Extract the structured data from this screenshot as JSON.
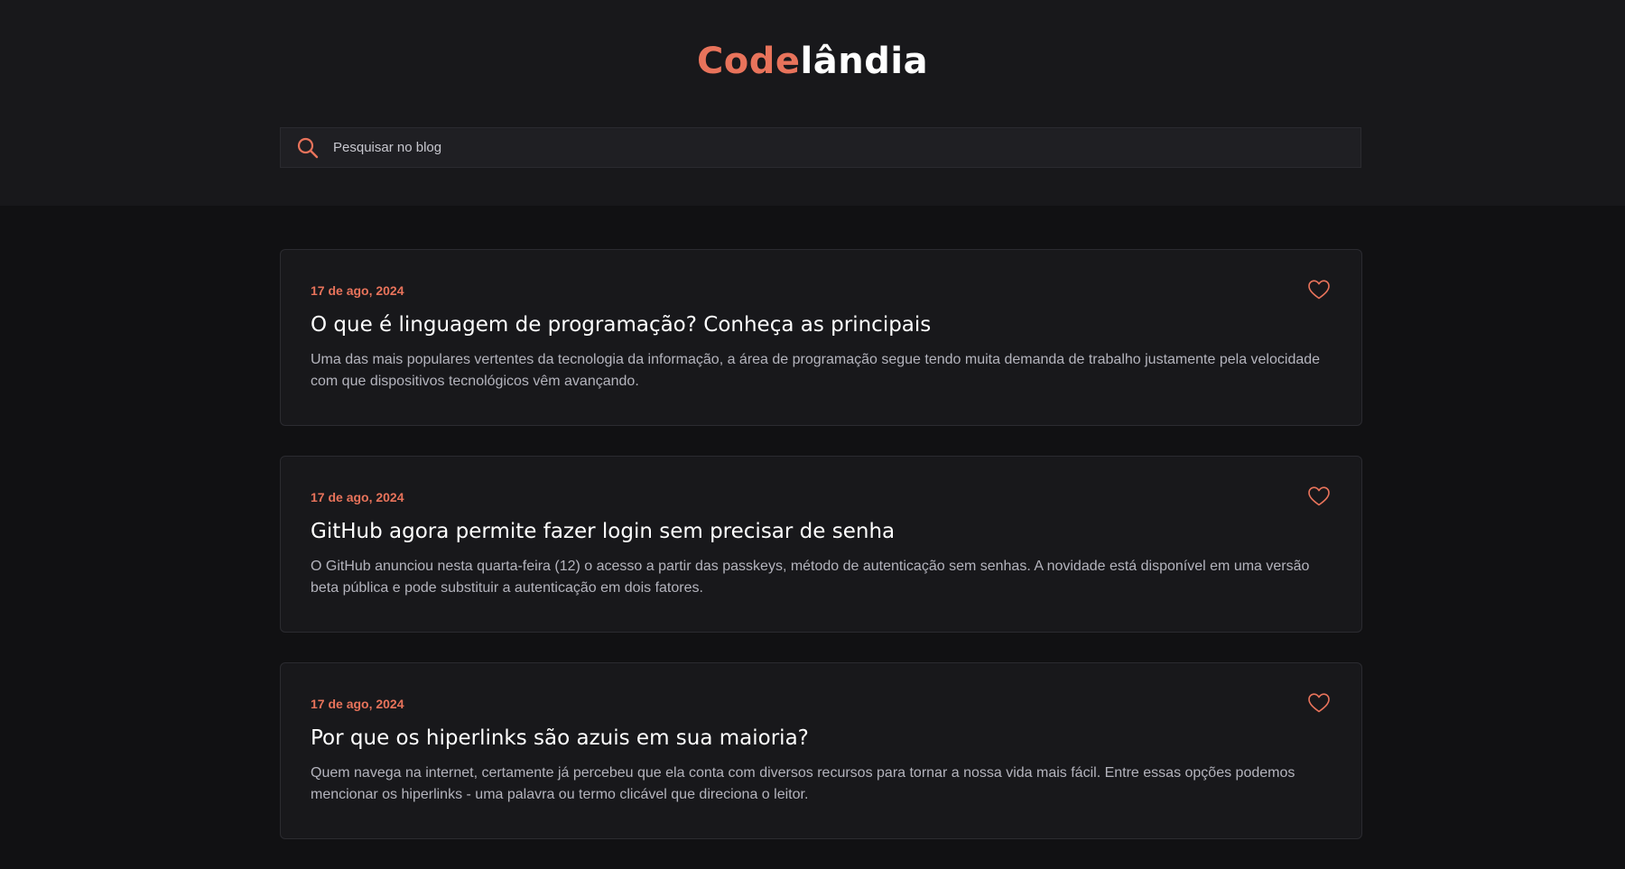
{
  "header": {
    "logo_accent": "Code",
    "logo_rest": "lândia",
    "search": {
      "placeholder": "Pesquisar no blog",
      "icon": "search-icon"
    }
  },
  "colors": {
    "accent": "#e8735b",
    "header_bg": "#18181b",
    "page_bg": "#111113",
    "card_bg": "#18181b"
  },
  "posts": [
    {
      "date": "17 de ago, 2024",
      "title": "O que é linguagem de programação? Conheça as principais",
      "excerpt": "Uma das mais populares vertentes da tecnologia da informação, a área de programação segue tendo muita demanda de trabalho justamente pela velocidade com que dispositivos tecnológicos vêm avançando.",
      "icon": "heart-icon"
    },
    {
      "date": "17 de ago, 2024",
      "title": "GitHub agora permite fazer login sem precisar de senha",
      "excerpt": "O GitHub anunciou nesta quarta-feira (12) o acesso a partir das passkeys, método de autenticação sem senhas. A novidade está disponível em uma versão beta pública e pode substituir a autenticação em dois fatores.",
      "icon": "heart-icon"
    },
    {
      "date": "17 de ago, 2024",
      "title": "Por que os hiperlinks são azuis em sua maioria?",
      "excerpt": "Quem navega na internet, certamente já percebeu que ela conta com diversos recursos para tornar a nossa vida mais fácil. Entre essas opções podemos mencionar os hiperlinks - uma palavra ou termo clicável que direciona o leitor.",
      "icon": "heart-icon"
    }
  ]
}
